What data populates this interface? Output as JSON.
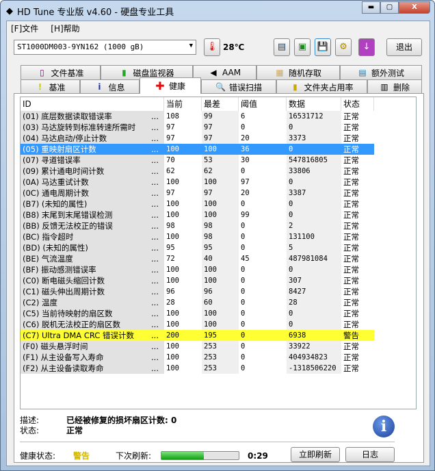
{
  "window": {
    "title": "HD Tune 专业版 v4.60 - 硬盘专业工具",
    "minimize": "▬",
    "maximize": "▢",
    "close": "X"
  },
  "menu": [
    {
      "label": "[F]文件"
    },
    {
      "label": "[H]帮助"
    }
  ],
  "toolbar": {
    "drive": "ST1000DM003-9YN162 (1000 gB)",
    "temperature": "28℃",
    "exit": "退出",
    "icons": [
      "copy-text-icon",
      "copy-screenshot-icon",
      "save-icon",
      "options-icon",
      "download-icon"
    ]
  },
  "tabs_top": [
    {
      "label": "文件基准",
      "icon": "file-benchmark-icon"
    },
    {
      "label": "磁盘监视器",
      "icon": "disk-monitor-icon"
    },
    {
      "label": "AAM",
      "icon": "speaker-icon"
    },
    {
      "label": "随机存取",
      "icon": "random-access-icon"
    },
    {
      "label": "额外测试",
      "icon": "extra-tests-icon"
    }
  ],
  "tabs_bottom": [
    {
      "label": "基准",
      "icon": "benchmark-icon"
    },
    {
      "label": "信息",
      "icon": "info-icon"
    },
    {
      "label": "健康",
      "icon": "health-cross-icon",
      "active": true
    },
    {
      "label": "错误扫描",
      "icon": "magnifier-icon"
    },
    {
      "label": "文件夹占用率",
      "icon": "folder-icon"
    },
    {
      "label": "删除",
      "icon": "trash-icon"
    }
  ],
  "table": {
    "headers": [
      "ID",
      "当前",
      "最差",
      "阈值",
      "数据",
      "状态"
    ],
    "rows": [
      [
        "(01) 底层数据读取错误率",
        "108",
        "99",
        "6",
        "16531712",
        "正常"
      ],
      [
        "(03) 马达旋转到标准转速所需时",
        "97",
        "97",
        "0",
        "0",
        "正常"
      ],
      [
        "(04) 马达启动/停止计数",
        "97",
        "97",
        "20",
        "3373",
        "正常"
      ],
      [
        "(05) 重映射扇区计数",
        "100",
        "100",
        "36",
        "0",
        "正常"
      ],
      [
        "(07) 寻道错误率",
        "70",
        "53",
        "30",
        "547816805",
        "正常"
      ],
      [
        "(09) 累计通电时间计数",
        "62",
        "62",
        "0",
        "33806",
        "正常"
      ],
      [
        "(0A) 马达重试计数",
        "100",
        "100",
        "97",
        "0",
        "正常"
      ],
      [
        "(0C) 通电周期计数",
        "97",
        "97",
        "20",
        "3387",
        "正常"
      ],
      [
        "(B7) (未知的属性)",
        "100",
        "100",
        "0",
        "0",
        "正常"
      ],
      [
        "(B8) 末尾到末尾错误检测",
        "100",
        "100",
        "99",
        "0",
        "正常"
      ],
      [
        "(BB) 反馈无法校正的错误",
        "98",
        "98",
        "0",
        "2",
        "正常"
      ],
      [
        "(BC) 指令超时",
        "100",
        "98",
        "0",
        "131100",
        "正常"
      ],
      [
        "(BD) (未知的属性)",
        "95",
        "95",
        "0",
        "5",
        "正常"
      ],
      [
        "(BE) 气流温度",
        "72",
        "40",
        "45",
        "487981084",
        "正常"
      ],
      [
        "(BF) 振动感测错误率",
        "100",
        "100",
        "0",
        "0",
        "正常"
      ],
      [
        "(C0) 断电磁头缩回计数",
        "100",
        "100",
        "0",
        "307",
        "正常"
      ],
      [
        "(C1) 磁头伸出周期计数",
        "96",
        "96",
        "0",
        "8427",
        "正常"
      ],
      [
        "(C2) 温度",
        "28",
        "60",
        "0",
        "28",
        "正常"
      ],
      [
        "(C5) 当前待映射的扇区数",
        "100",
        "100",
        "0",
        "0",
        "正常"
      ],
      [
        "(C6) 脱机无法校正的扇区数",
        "100",
        "100",
        "0",
        "0",
        "正常"
      ],
      [
        "(C7) Ultra DMA CRC 错误计数",
        "200",
        "195",
        "0",
        "6938",
        "警告"
      ],
      [
        "(F0) 磁头悬浮时间",
        "100",
        "253",
        "0",
        "33922",
        "正常"
      ],
      [
        "(F1) 从主设备写入寿命",
        "100",
        "253",
        "0",
        "404934823",
        "正常"
      ],
      [
        "(F2) 从主设备读取寿命",
        "100",
        "253",
        "0",
        "-1318506220",
        "正常"
      ]
    ],
    "ellipsis": "...",
    "selected_row": 3,
    "warning_row": 20,
    "colors": {
      "selected": "#3399ff",
      "warning": "#ffff33"
    }
  },
  "details": {
    "desc_label": "描述:",
    "desc_value": "已经被修复的损坏扇区计数: 0",
    "status_label": "状态:",
    "status_value": "正常"
  },
  "footer": {
    "health_label": "健康状态:",
    "health_value": "警告",
    "health_color": "#d4b800",
    "refresh_label": "下次刷新:",
    "progress": 0.55,
    "countdown": "0:29",
    "refresh_button": "立即刷新",
    "log_button": "日志"
  }
}
